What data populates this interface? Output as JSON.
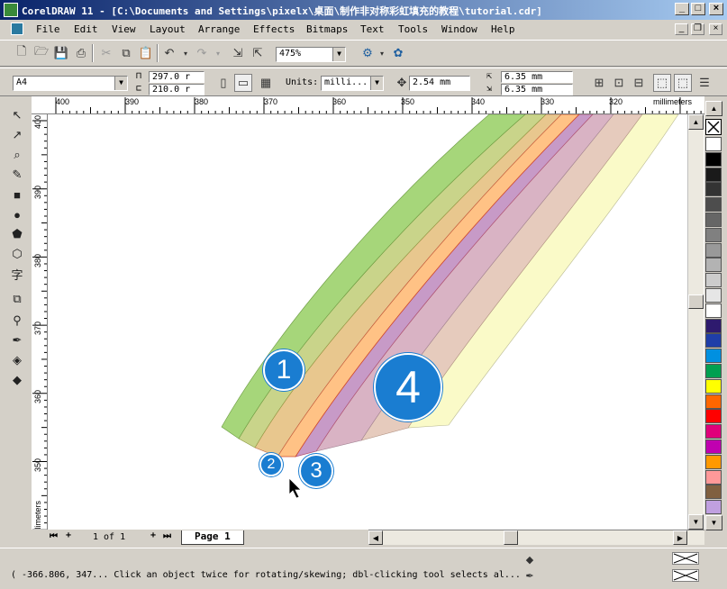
{
  "window": {
    "title": "CorelDRAW 11 - [C:\\Documents and Settings\\pixelx\\桌面\\制作非对称彩虹填充的教程\\tutorial.cdr]"
  },
  "menu": [
    "File",
    "Edit",
    "View",
    "Layout",
    "Arrange",
    "Effects",
    "Bitmaps",
    "Text",
    "Tools",
    "Window",
    "Help"
  ],
  "toolbar": {
    "zoom": "475%"
  },
  "propbar": {
    "paper": "A4",
    "width": "297.0 r",
    "height": "210.0 r",
    "units_label": "Units:",
    "units": "milli...",
    "nudge": "2.54 mm",
    "dup_x": "6.35 mm",
    "dup_y": "6.35 mm"
  },
  "ruler": {
    "h_ticks": [
      "400",
      "390",
      "380",
      "370",
      "360",
      "350",
      "340",
      "330",
      "320"
    ],
    "h_unit": "millimeters",
    "v_ticks": [
      "400",
      "390",
      "380",
      "370",
      "360",
      "350"
    ],
    "v_unit": "millimeters"
  },
  "pages": {
    "count": "1 of 1",
    "tab": "Page 1"
  },
  "status": {
    "text": "( -366.806, 347... Click an object twice for rotating/skewing; dbl-clicking tool selects al..."
  },
  "badges": [
    "1",
    "2",
    "3",
    "4"
  ],
  "colors": {
    "band1": "#a6d67a",
    "band2": "#c9d48a",
    "band3": "#e8c78e",
    "band4": "#ffc285",
    "band5": "#c79ac7",
    "band6": "#d9b3c4",
    "band7": "#e6cbbd",
    "band8": "#fafac8",
    "accent": "#1a7dd1"
  },
  "palette": [
    "#ffffff",
    "#000000",
    "#1a1a1a",
    "#333333",
    "#4d4d4d",
    "#666666",
    "#808080",
    "#999999",
    "#b3b3b3",
    "#cccccc",
    "#e6e6e6",
    "#ffffff",
    "#2e1a6e",
    "#1f3ea8",
    "#0090e0",
    "#00a050",
    "#ffff00",
    "#ff6600",
    "#ff0000",
    "#e0007a",
    "#c000b0",
    "#ff9900",
    "#ff9999",
    "#806040",
    "#c0a0e0",
    "#b0b0d0"
  ]
}
